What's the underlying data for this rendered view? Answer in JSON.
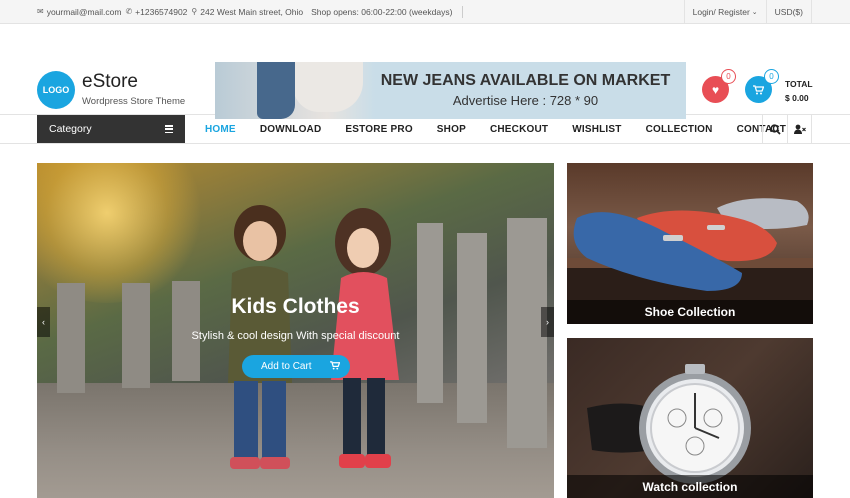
{
  "topbar": {
    "email": "yourmail@mail.com",
    "phone": "+1236574902",
    "address": "242 West Main street, Ohio",
    "hours": "Shop opens: 06:00-22:00 (weekdays)",
    "login": "Login/ Register",
    "currency": "USD($)"
  },
  "header": {
    "logo_text": "LOGO",
    "site_title": "eStore",
    "tagline": "Wordpress Store Theme",
    "banner_line1": "NEW JEANS AVAILABLE ON MARKET",
    "banner_line2": "Advertise Here : 728 * 90",
    "wishlist_count": "0",
    "cart_count": "0",
    "cart_total_label": "TOTAL",
    "cart_total_amount": "$ 0.00"
  },
  "nav": {
    "category_label": "Category",
    "items": [
      "HOME",
      "DOWNLOAD",
      "ESTORE PRO",
      "SHOP",
      "CHECKOUT",
      "WISHLIST",
      "COLLECTION",
      "CONTACT"
    ],
    "active": "HOME"
  },
  "slider": {
    "title": "Kids Clothes",
    "subtitle": "Stylish & cool design With special discount",
    "button": "Add to Cart"
  },
  "promos": [
    {
      "caption": "Shoe Collection"
    },
    {
      "caption": "Watch collection"
    }
  ],
  "icons": {
    "email": "envelope-icon",
    "phone": "phone-icon",
    "address": "map-marker-icon",
    "wishlist": "heart-icon",
    "cart": "shopping-cart-icon",
    "search": "search-icon",
    "user": "user-icon"
  },
  "colors": {
    "accent": "#1aa5e0",
    "wishlist": "#e84e55",
    "category_bg": "#333333"
  }
}
